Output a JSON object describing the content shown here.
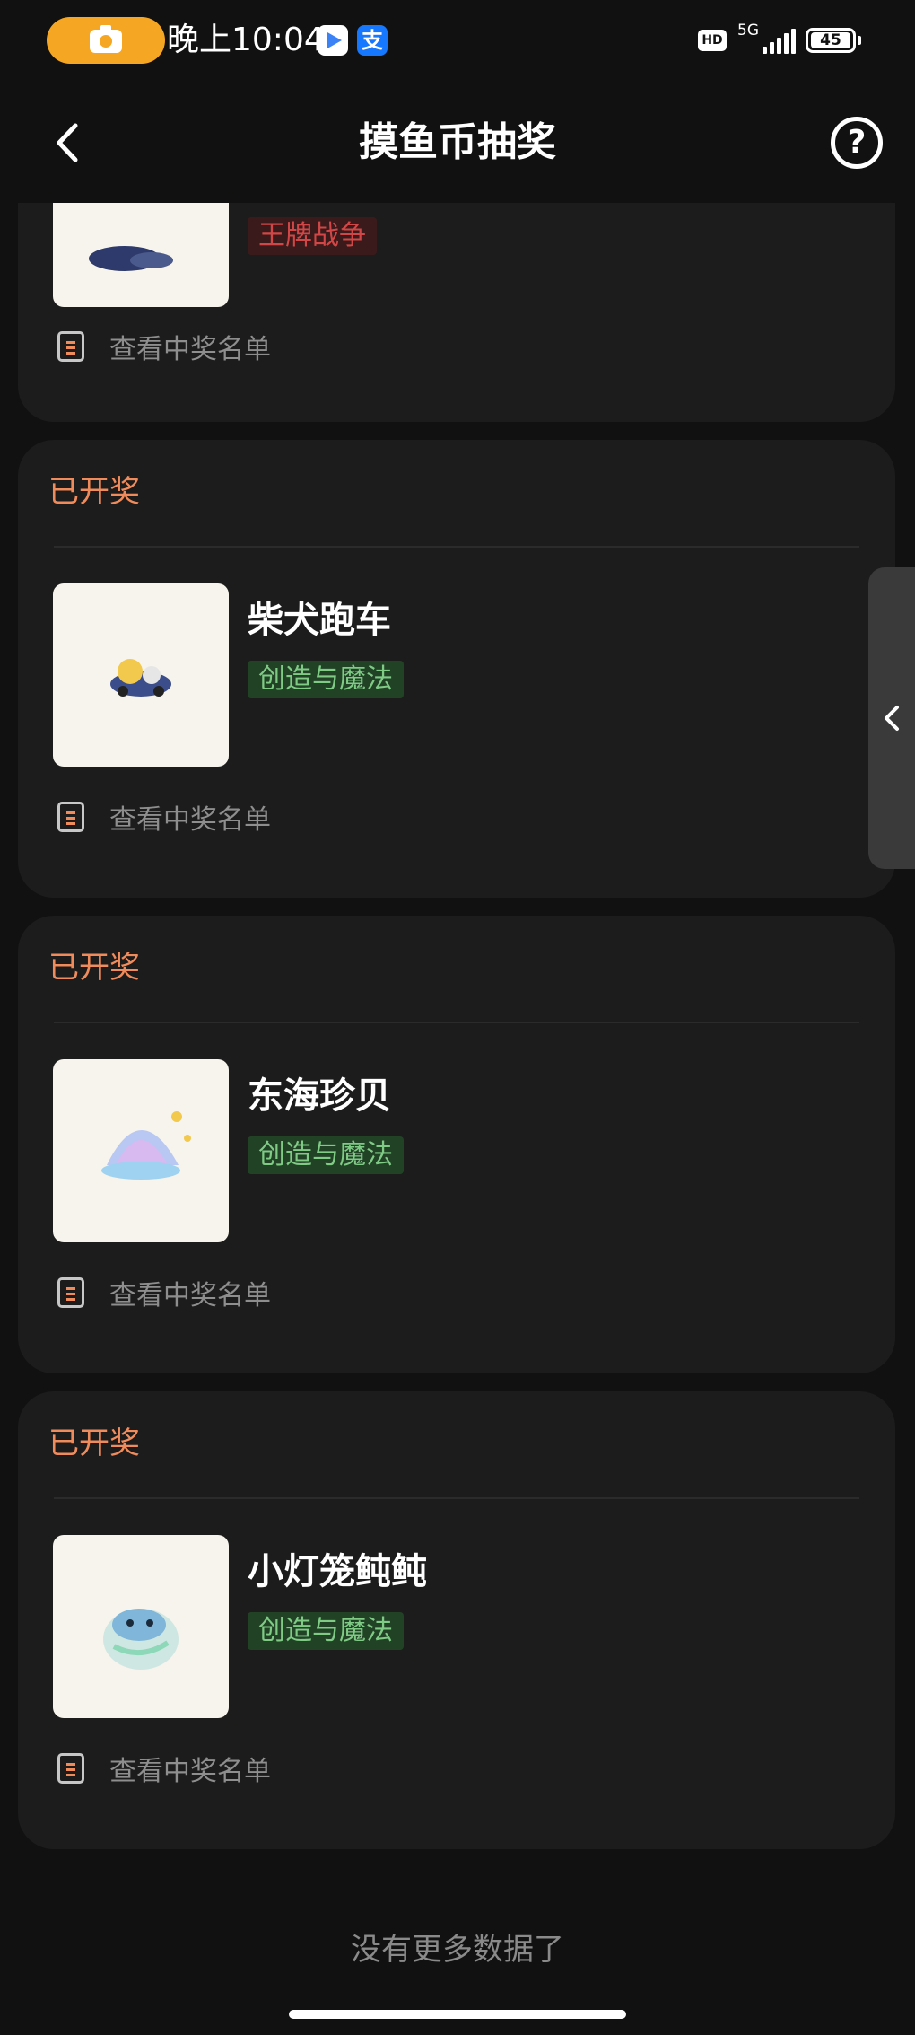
{
  "status_bar": {
    "time": "晚上10:04",
    "alipay_glyph": "支",
    "hd_label": "HD",
    "network": "5G",
    "battery": "45",
    "icons": [
      "camera-record-icon",
      "play-store-icon",
      "alipay-icon",
      "signal-icon",
      "battery-icon"
    ]
  },
  "nav": {
    "title": "摸鱼币抽奖",
    "help_glyph": "?",
    "icons": [
      "back-arrow-icon",
      "help-icon"
    ]
  },
  "cards": [
    {
      "prize_name": "",
      "tag": "王牌战争",
      "tag_color": "#d14747",
      "winners_label": "查看中奖名单"
    },
    {
      "status": "已开奖",
      "prize_name": "柴犬跑车",
      "tag": "创造与魔法",
      "tag_color": "#7fcb86",
      "winners_label": "查看中奖名单"
    },
    {
      "status": "已开奖",
      "prize_name": "东海珍贝",
      "tag": "创造与魔法",
      "tag_color": "#7fcb86",
      "winners_label": "查看中奖名单"
    },
    {
      "status": "已开奖",
      "prize_name": "小灯笼鲀鲀",
      "tag": "创造与魔法",
      "tag_color": "#7fcb86",
      "winners_label": "查看中奖名单"
    }
  ],
  "footer": {
    "no_more": "没有更多数据了"
  },
  "colors": {
    "accent_status": "#f08c5c",
    "card_background": "#1c1c1c",
    "page_background": "#111111"
  }
}
